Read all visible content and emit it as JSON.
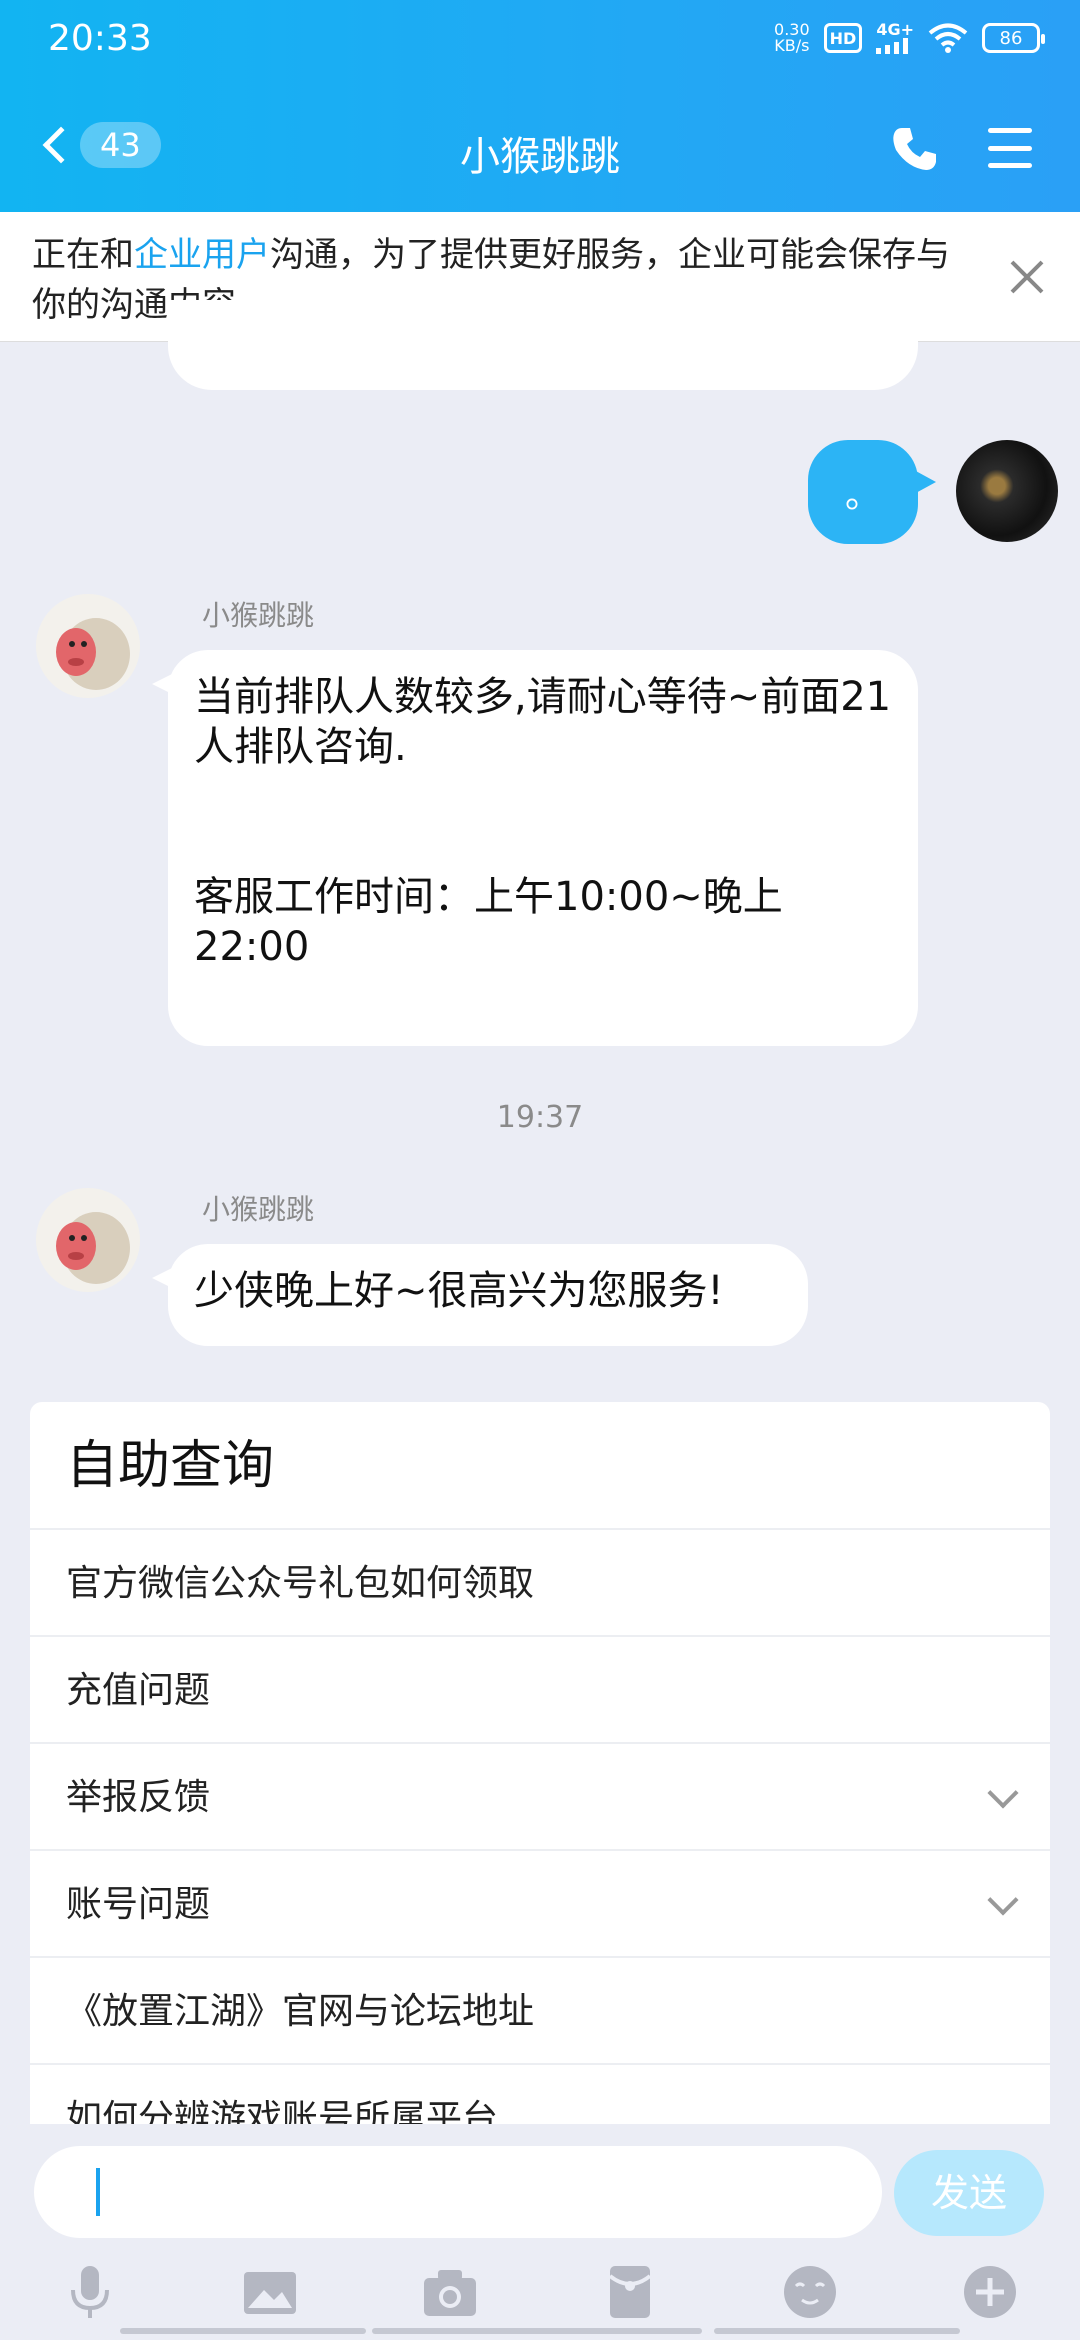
{
  "status_bar": {
    "time": "20:33",
    "net_speed_top": "0.30",
    "net_speed_bottom": "KB/s",
    "hd": "HD",
    "network": "4G+",
    "battery": "86"
  },
  "nav": {
    "back_count": "43",
    "title": "小猴跳跳"
  },
  "notice": {
    "prefix": "正在和",
    "highlight": "企业用户",
    "suffix": "沟通，为了提供更好服务，企业可能会保存与你的沟通内容。"
  },
  "messages": {
    "my_message": "。",
    "msg1": {
      "sender": "小猴跳跳",
      "line1": "当前排队人数较多,请耐心等待~前面21人排队咨询.",
      "line2": "客服工作时间：上午10:00~晚上22:00"
    },
    "timestamp": "19:37",
    "msg2": {
      "sender": "小猴跳跳",
      "text": "少侠晚上好~很高兴为您服务!"
    }
  },
  "self_service": {
    "title": "自助查询",
    "items": [
      {
        "label": "官方微信公众号礼包如何领取"
      },
      {
        "label": "充值问题"
      },
      {
        "label": "举报反馈"
      },
      {
        "label": "账号问题"
      },
      {
        "label": "《放置江湖》官网与论坛地址"
      },
      {
        "label": "如何分辨游戏账号所属平台"
      }
    ]
  },
  "input": {
    "placeholder": "",
    "send_label": "发送"
  },
  "toolbar": [
    "microphone-icon",
    "image-icon",
    "camera-icon",
    "red-packet-icon",
    "emoji-icon",
    "plus-icon"
  ],
  "colors": {
    "accent": "#1aa3ef",
    "bubble_mine": "#2cb4f5",
    "background": "#ebedf5"
  }
}
